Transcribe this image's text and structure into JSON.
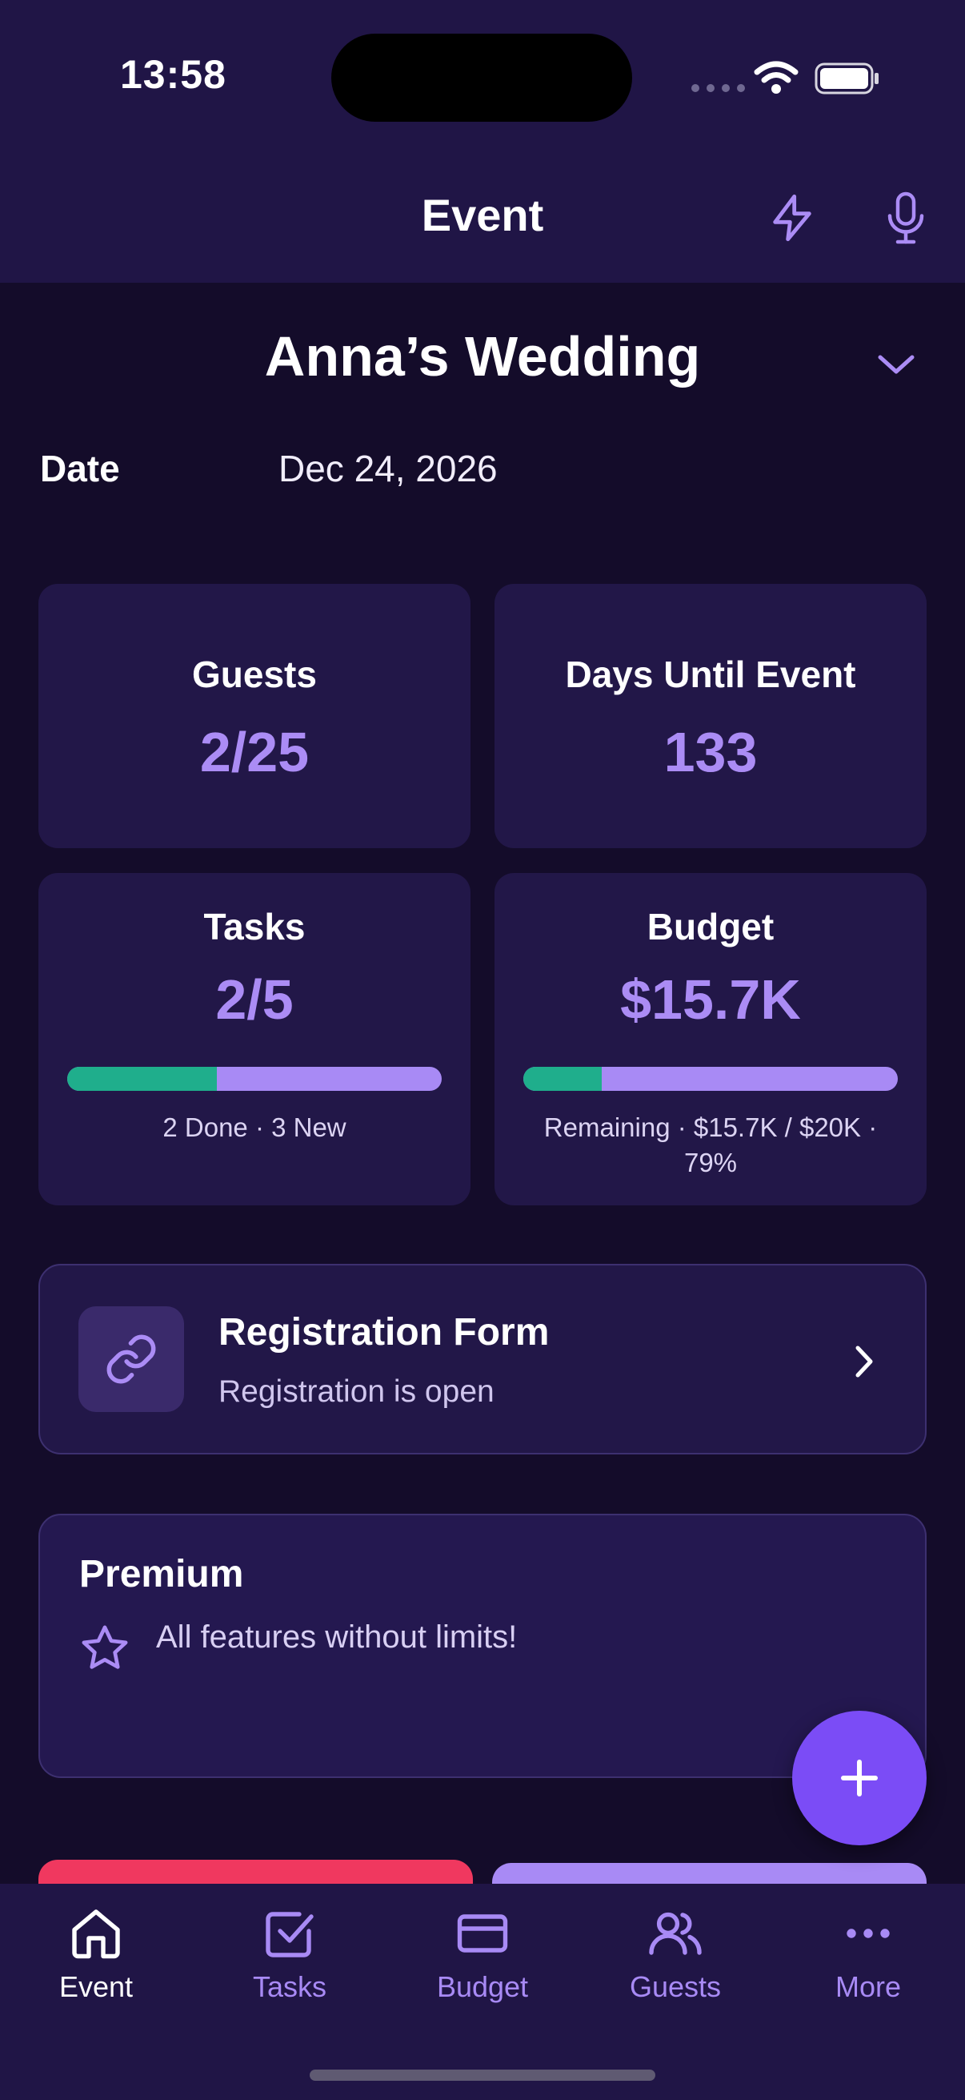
{
  "status_bar": {
    "time": "13:58"
  },
  "header": {
    "title": "Event"
  },
  "event": {
    "name": "Anna’s Wedding",
    "date_label": "Date",
    "date_value": "Dec 24, 2026"
  },
  "stats": {
    "guests": {
      "title": "Guests",
      "value": "2/25"
    },
    "days": {
      "title": "Days Until Event",
      "value": "133"
    },
    "tasks": {
      "title": "Tasks",
      "value": "2/5",
      "progress": 0.4,
      "summary": "2 Done · 3 New"
    },
    "budget": {
      "title": "Budget",
      "value": "$15.7K",
      "progress": 0.21,
      "summary": "Remaining · $15.7K / $20K · 79%"
    }
  },
  "registration": {
    "title": "Registration Form",
    "subtitle": "Registration is open"
  },
  "premium": {
    "title": "Premium",
    "text": "All features without limits!"
  },
  "nav": {
    "items": [
      {
        "label": "Event",
        "icon": "home-icon",
        "active": true
      },
      {
        "label": "Tasks",
        "icon": "checkbox-icon",
        "active": false
      },
      {
        "label": "Budget",
        "icon": "card-icon",
        "active": false
      },
      {
        "label": "Guests",
        "icon": "users-icon",
        "active": false
      },
      {
        "label": "More",
        "icon": "more-icon",
        "active": false
      }
    ]
  },
  "colors": {
    "background": "#140c2a",
    "surface": "#221748",
    "accent": "#ab8cf5",
    "fab": "#7b4cf6",
    "success": "#1fae8c",
    "danger": "#f0385f"
  }
}
